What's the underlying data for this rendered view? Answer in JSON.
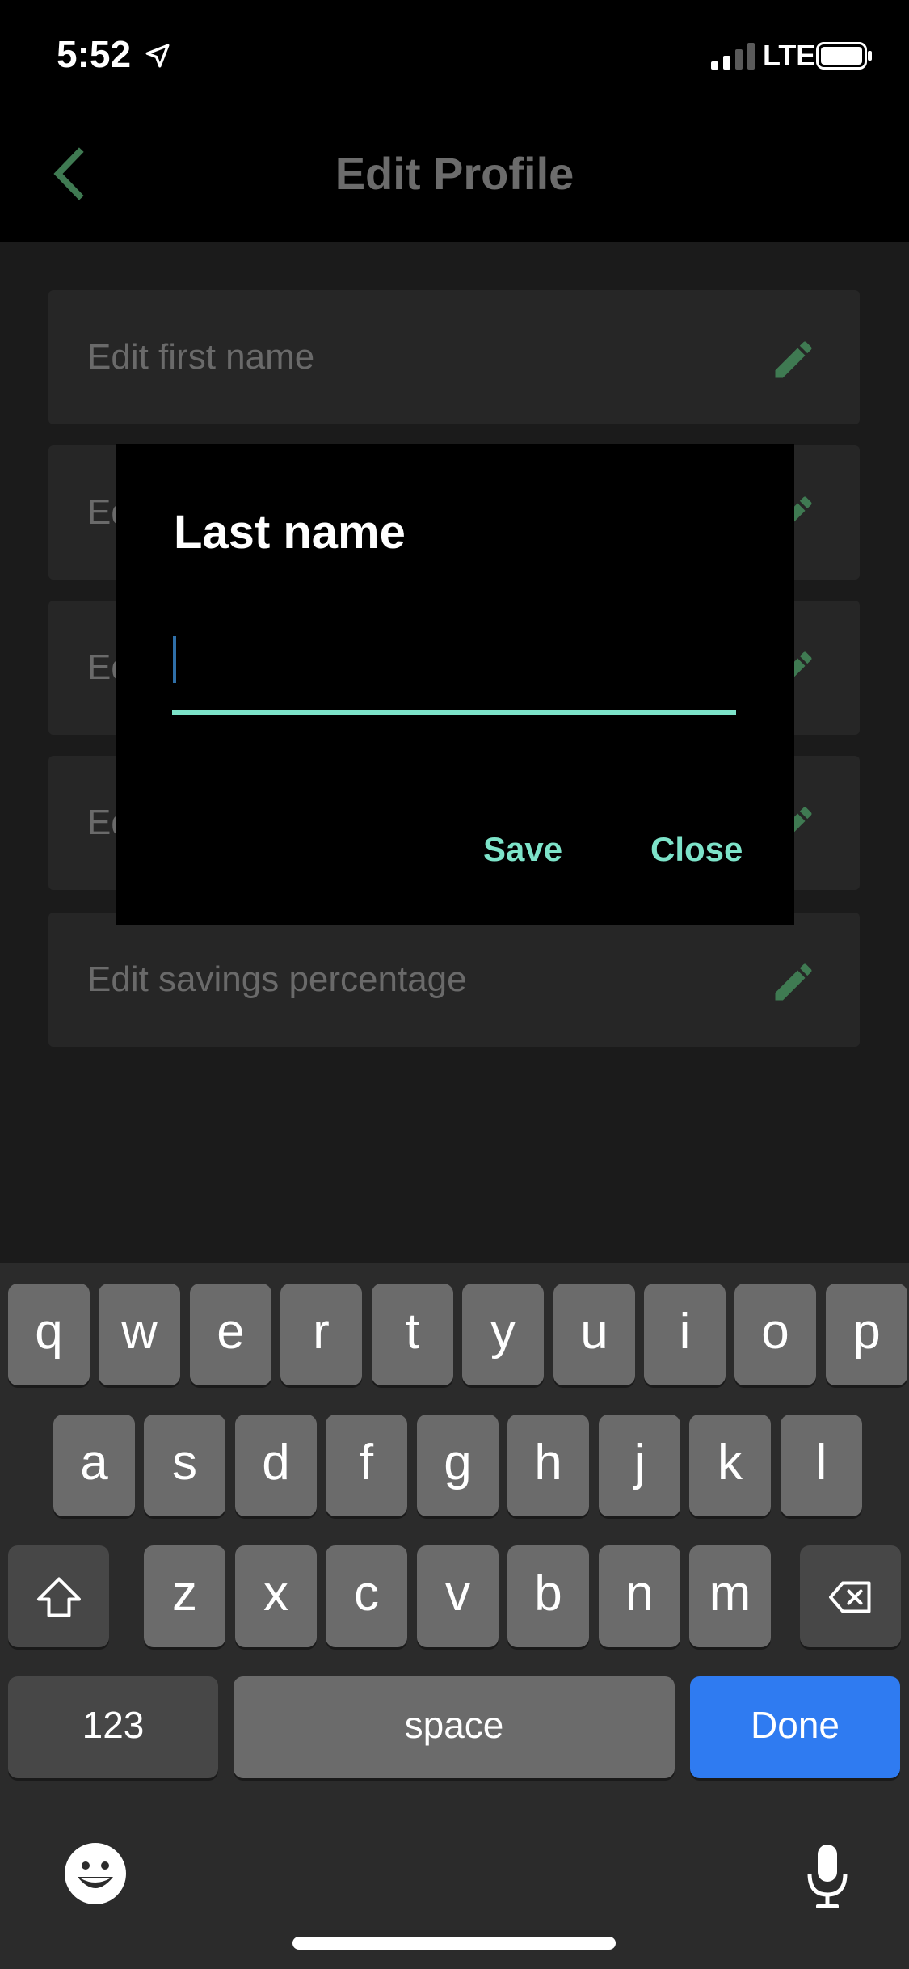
{
  "status_bar": {
    "time": "5:52",
    "network": "LTE"
  },
  "header": {
    "title": "Edit Profile"
  },
  "fields": [
    {
      "label": "Edit first name"
    },
    {
      "label": "Ed"
    },
    {
      "label": "Ed"
    },
    {
      "label": "Ed"
    },
    {
      "label": "Edit savings percentage"
    }
  ],
  "dialog": {
    "title": "Last name",
    "input_value": "",
    "save_label": "Save",
    "close_label": "Close"
  },
  "keyboard": {
    "row1": [
      "q",
      "w",
      "e",
      "r",
      "t",
      "y",
      "u",
      "i",
      "o",
      "p"
    ],
    "row2": [
      "a",
      "s",
      "d",
      "f",
      "g",
      "h",
      "j",
      "k",
      "l"
    ],
    "row3": [
      "z",
      "x",
      "c",
      "v",
      "b",
      "n",
      "m"
    ],
    "num_label": "123",
    "space_label": "space",
    "done_label": "Done"
  },
  "colors": {
    "accent": "#7de3c9",
    "pencil": "#3f7a52",
    "done": "#2f7bf1"
  }
}
